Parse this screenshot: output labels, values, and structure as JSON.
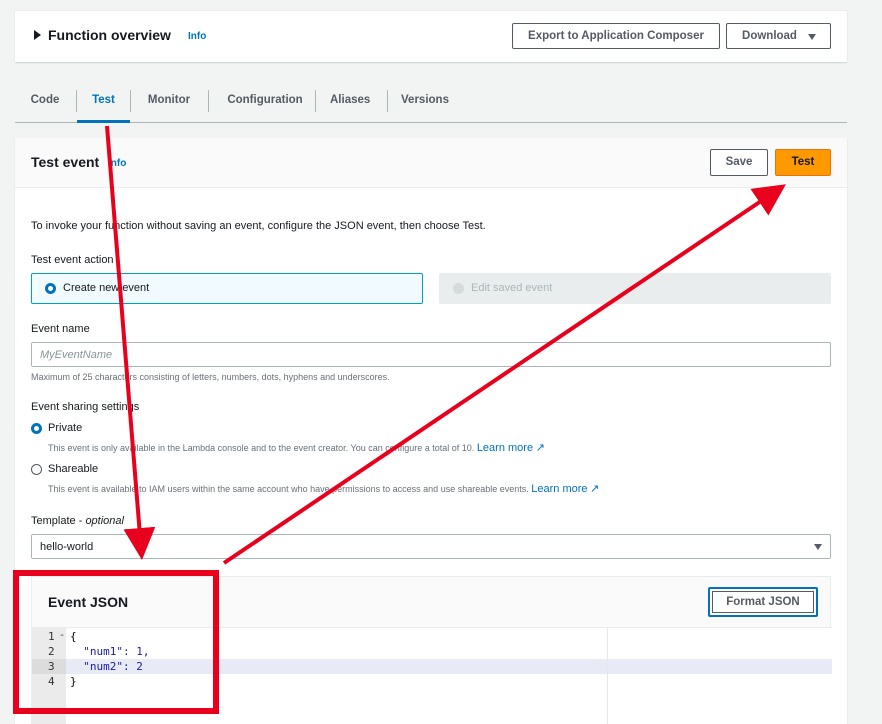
{
  "overview": {
    "title": "Function overview",
    "info": "Info",
    "export_button": "Export to Application Composer",
    "download_button": "Download"
  },
  "tabs": [
    {
      "label": "Code",
      "active": false
    },
    {
      "label": "Test",
      "active": true
    },
    {
      "label": "Monitor",
      "active": false
    },
    {
      "label": "Configuration",
      "active": false
    },
    {
      "label": "Aliases",
      "active": false
    },
    {
      "label": "Versions",
      "active": false
    }
  ],
  "test_event": {
    "title": "Test event",
    "info": "Info",
    "save_button": "Save",
    "test_button": "Test",
    "description": "To invoke your function without saving an event, configure the JSON event, then choose Test.",
    "action_label": "Test event action",
    "action_create": "Create new event",
    "action_edit": "Edit saved event",
    "event_name_label": "Event name",
    "event_name_placeholder": "MyEventName",
    "event_name_hint": "Maximum of 25 characters consisting of letters, numbers, dots, hyphens and underscores.",
    "sharing_label": "Event sharing settings",
    "private_label": "Private",
    "private_hint": "This event is only available in the Lambda console and to the event creator. You can configure a total of 10.",
    "shareable_label": "Shareable",
    "shareable_hint": "This event is available to IAM users within the same account who have permissions to access and use shareable events.",
    "learn_more": "Learn more",
    "template_label": "Template",
    "template_optional": "optional",
    "template_value": "hello-world"
  },
  "event_json": {
    "title": "Event JSON",
    "format_button": "Format JSON",
    "lines": [
      "{",
      "  \"num1\": 1,",
      "  \"num2\": 2",
      "}"
    ],
    "line_numbers": [
      "1",
      "2",
      "3",
      "4"
    ]
  },
  "colors": {
    "primary_button": "#ff9900",
    "link": "#0073bb",
    "annotation": "#e8001c"
  }
}
